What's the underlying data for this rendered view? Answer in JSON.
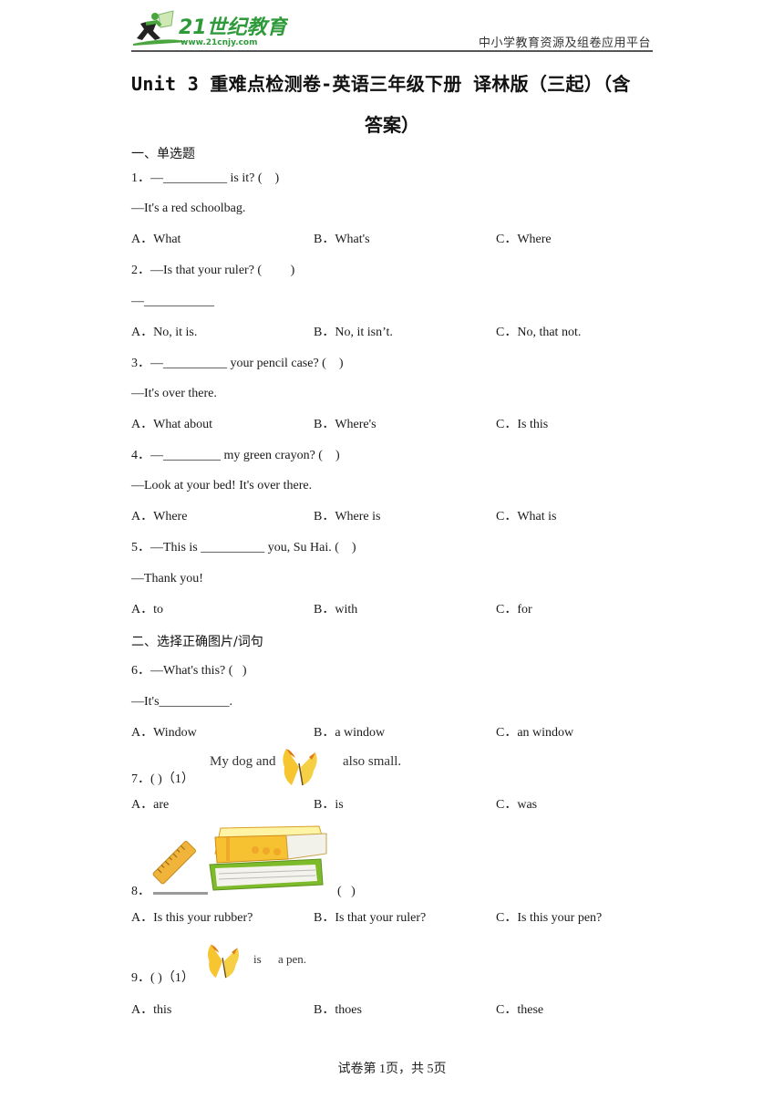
{
  "header": {
    "logo_text": "21世纪教育",
    "logo_url_text": "www.21cnjy.com",
    "tagline": "中小学教育资源及组卷应用平台",
    "colors": {
      "logo_green": "#2e9a3a",
      "logo_dark": "#222222",
      "rule": "#555555"
    }
  },
  "title": {
    "line1": "Unit 3  重难点检测卷-英语三年级下册 译林版（三起）（含",
    "line2": "答案）"
  },
  "sections": [
    {
      "label": "一、单选题"
    },
    {
      "label": "二、选择正确图片/词句"
    }
  ],
  "questions": [
    {
      "stem": "1．—__________ is it? (    )",
      "reply": "—It's a red schoolbag.",
      "options": [
        "A．What",
        "B．What's",
        "C．Where"
      ]
    },
    {
      "stem": "2．—Is that your ruler? (         )",
      "reply": "—___________",
      "options": [
        "A．No, it is.",
        "B．No, it isn’t.",
        "C．No, that not."
      ]
    },
    {
      "stem": "3．—__________ your pencil case? (    )",
      "reply": "—It's over there.",
      "options": [
        "A．What about",
        "B．Where's",
        "C．Is this"
      ]
    },
    {
      "stem": "4．—_________ my green crayon? (    )",
      "reply": "—Look at your bed! It's over there.",
      "options": [
        "A．Where",
        "B．Where is",
        "C．What is"
      ]
    },
    {
      "stem": "5．—This is __________ you, Su Hai. (    )",
      "reply": "—Thank you!",
      "options": [
        "A．to",
        "B．with",
        "C．for"
      ]
    },
    {
      "stem": "6．—What's this? (   )",
      "reply": "—It's___________.",
      "options": [
        "A．Window",
        "B．a window",
        "C．an window"
      ]
    },
    {
      "stem": "7．( )（1）",
      "image_text_left": "My dog and",
      "image_text_right": "also small.",
      "image_icon": "butterfly",
      "options": [
        "A．are",
        "B．is",
        "C．was"
      ]
    },
    {
      "stem": "8．",
      "bracket": "(   )",
      "image_icon": "ruler-and-books",
      "options": [
        "A．Is this your rubber?",
        "B．Is that your ruler?",
        "C．Is this your pen?"
      ]
    },
    {
      "stem": "9．( )（1）",
      "image_text_left": "is",
      "image_text_right": "a pen.",
      "image_icon": "butterfly",
      "options": [
        "A．this",
        "B．thoes",
        "C．these"
      ]
    }
  ],
  "footer": {
    "page_text": "试卷第 1页，共 5页"
  }
}
